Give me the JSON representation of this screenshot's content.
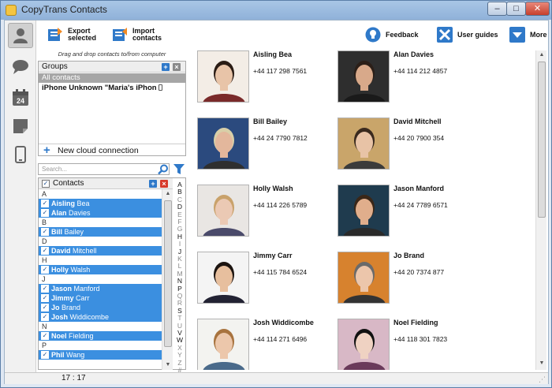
{
  "window": {
    "title": "CopyTrans Contacts",
    "min": "–",
    "max": "□",
    "close": "✕"
  },
  "nav": [
    "contacts-icon",
    "messages-icon",
    "calendar-icon",
    "notes-icon",
    "device-icon"
  ],
  "calendar_day": "24",
  "toolbar": {
    "export_l1": "Export",
    "export_l2": "selected",
    "import_l1": "Import",
    "import_l2": "contacts",
    "feedback": "Feedback",
    "guides": "User guides",
    "more": "More"
  },
  "left": {
    "hint": "Drag and drop contacts to/from computer",
    "groups_title": "Groups",
    "groups": [
      "All contacts",
      "iPhone Unknown \"Maria's iPhon"
    ],
    "cloud": "New cloud connection",
    "search_placeholder": "Search...",
    "contacts_title": "Contacts",
    "check": "✓"
  },
  "list": [
    {
      "letter": "A"
    },
    {
      "first": "Aisling",
      "last": "Bea"
    },
    {
      "first": "Alan",
      "last": "Davies"
    },
    {
      "letter": "B"
    },
    {
      "first": "Bill",
      "last": "Bailey"
    },
    {
      "letter": "D"
    },
    {
      "first": "David",
      "last": "Mitchell"
    },
    {
      "letter": "H"
    },
    {
      "first": "Holly",
      "last": "Walsh"
    },
    {
      "letter": "J"
    },
    {
      "first": "Jason",
      "last": "Manford"
    },
    {
      "first": "Jimmy",
      "last": "Carr"
    },
    {
      "first": "Jo",
      "last": "Brand"
    },
    {
      "first": "Josh",
      "last": "Widdicombe"
    },
    {
      "letter": "N"
    },
    {
      "first": "Noel",
      "last": "Fielding"
    },
    {
      "letter": "P"
    },
    {
      "first": "Phil",
      "last": "Wang"
    }
  ],
  "alphabet": [
    {
      "c": "A",
      "on": true
    },
    {
      "c": "B",
      "on": true
    },
    {
      "c": "C",
      "on": false
    },
    {
      "c": "D",
      "on": true
    },
    {
      "c": "E",
      "on": false
    },
    {
      "c": "F",
      "on": false
    },
    {
      "c": "G",
      "on": false
    },
    {
      "c": "H",
      "on": true
    },
    {
      "c": "I",
      "on": false
    },
    {
      "c": "J",
      "on": true
    },
    {
      "c": "K",
      "on": false
    },
    {
      "c": "L",
      "on": false
    },
    {
      "c": "M",
      "on": false
    },
    {
      "c": "N",
      "on": true
    },
    {
      "c": "P",
      "on": true
    },
    {
      "c": "Q",
      "on": false
    },
    {
      "c": "R",
      "on": false
    },
    {
      "c": "S",
      "on": true
    },
    {
      "c": "T",
      "on": false
    },
    {
      "c": "U",
      "on": false
    },
    {
      "c": "V",
      "on": true
    },
    {
      "c": "W",
      "on": true
    },
    {
      "c": "X",
      "on": false
    },
    {
      "c": "Y",
      "on": false
    },
    {
      "c": "Z",
      "on": false
    },
    {
      "c": "#",
      "on": false
    }
  ],
  "cards": [
    {
      "name": "Aisling Bea",
      "phone": "+44 117 298 7561",
      "bg": "#f3ede6",
      "skin": "#e8c4a8",
      "hair": "#2a1c14",
      "shirt": "#7a2a2a"
    },
    {
      "name": "Alan Davies",
      "phone": "+44 114 212 4857",
      "bg": "#2e2e2e",
      "skin": "#d8a98a",
      "hair": "#2b1f18",
      "shirt": "#1a1a1a"
    },
    {
      "name": "Bill Bailey",
      "phone": "+44 24 7790 7812",
      "bg": "#2b4a7e",
      "skin": "#e3b79c",
      "hair": "#d8cfa8",
      "shirt": "#2f2f2f"
    },
    {
      "name": "David Mitchell",
      "phone": "+44 20 7900 354",
      "bg": "#c9a56a",
      "skin": "#e8c3a6",
      "hair": "#3a2a1e",
      "shirt": "#3b3b3b"
    },
    {
      "name": "Holly Walsh",
      "phone": "+44 114 226 5789",
      "bg": "#e9e6e3",
      "skin": "#ebc9b4",
      "hair": "#c9a26b",
      "shirt": "#4a4a6a"
    },
    {
      "name": "Jason Manford",
      "phone": "+44 24 7789 6571",
      "bg": "#1f3b4e",
      "skin": "#e0ae8c",
      "hair": "#3a2718",
      "shirt": "#2a2a2a"
    },
    {
      "name": "Jimmy Carr",
      "phone": "+44 115 784 6524",
      "bg": "#f4f4f4",
      "skin": "#e7bf9e",
      "hair": "#1c1410",
      "shirt": "#222233"
    },
    {
      "name": "Jo Brand",
      "phone": "+44 20 7374 877",
      "bg": "#d7822e",
      "skin": "#ecc6ab",
      "hair": "#6a6a6a",
      "shirt": "#333"
    },
    {
      "name": "Josh Widdicombe",
      "phone": "+44 114 271 6496",
      "bg": "#f3f3f0",
      "skin": "#ecc7ab",
      "hair": "#a8733e",
      "shirt": "#4a6a8a"
    },
    {
      "name": "Noel Fielding",
      "phone": "+44 118 301 7823",
      "bg": "#d8b8c6",
      "skin": "#efd2c2",
      "hair": "#111",
      "shirt": "#6a3a5a"
    }
  ],
  "status": {
    "count": "17 : 17",
    "grip": "⋰"
  },
  "colors": {
    "accent": "#2f79c9",
    "selection": "#3b8fe0",
    "close": "#c7402d"
  }
}
